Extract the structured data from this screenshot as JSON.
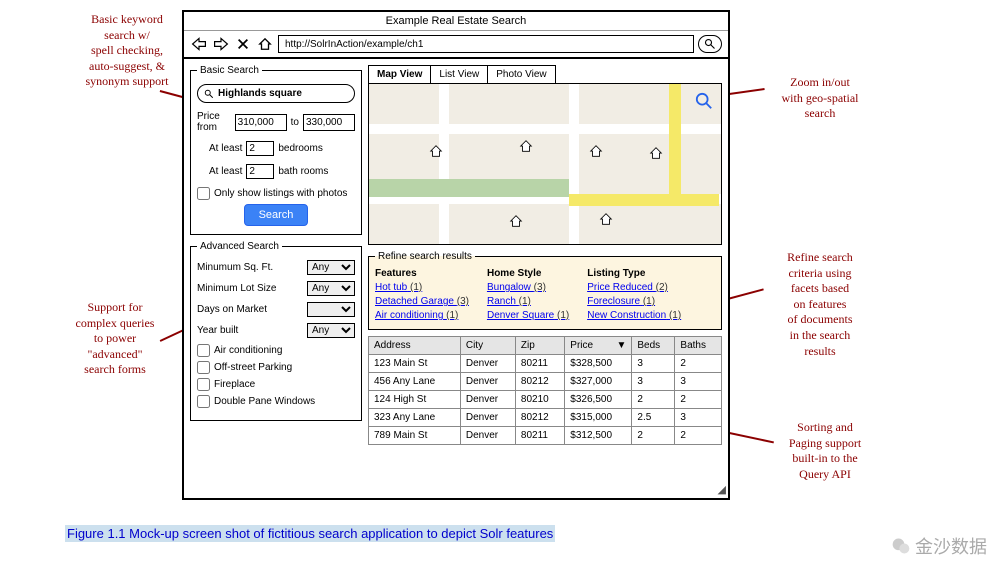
{
  "annotations": {
    "a1": "Basic keyword\nsearch w/\nspell checking,\nauto-suggest, &\nsynonym support",
    "a2": "Support for\ncomplex queries\nto power\n\"advanced\"\nsearch forms",
    "a3": "Zoom in/out\nwith geo-spatial\nsearch",
    "a4": "Refine search\ncriteria using\nfacets based\non features\nof documents\nin the search\nresults",
    "a5": "Sorting and\nPaging support\nbuilt-in to the\nQuery API"
  },
  "window": {
    "title": "Example Real Estate Search",
    "url": "http://SolrInAction/example/ch1"
  },
  "basic": {
    "legend": "Basic Search",
    "query": "Highlands square",
    "price_from_label": "Price from",
    "price_from": "310,000",
    "to": "to",
    "price_to": "330,000",
    "atleast1": "At least",
    "beds_val": "2",
    "bedrooms": "bedrooms",
    "atleast2": "At least",
    "baths_val": "2",
    "bathrooms": "bath rooms",
    "photos_only": "Only show listings with photos",
    "search_btn": "Search"
  },
  "advanced": {
    "legend": "Advanced Search",
    "sqft": "Minumum Sq. Ft.",
    "lot": "Minimum Lot Size",
    "days": "Days on Market",
    "year": "Year built",
    "any": "Any",
    "ac": "Air conditioning",
    "parking": "Off-street Parking",
    "fireplace": "Fireplace",
    "windows": "Double Pane Windows"
  },
  "tabs": {
    "map": "Map View",
    "list": "List View",
    "photo": "Photo View"
  },
  "refine": {
    "legend": "Refine search results",
    "features": "Features",
    "f1": "Hot tub",
    "f1c": "(1)",
    "f2": "Detached Garage",
    "f2c": "(3)",
    "f3": "Air conditioning",
    "f3c": "(1)",
    "home": "Home Style",
    "h1": "Bungalow",
    "h1c": "(3)",
    "h2": "Ranch",
    "h2c": "(1)",
    "h3": "Denver Square",
    "h3c": "(1)",
    "listing": "Listing Type",
    "l1": "Price Reduced",
    "l1c": "(2)",
    "l2": "Foreclosure",
    "l2c": "(1)",
    "l3": "New Construction",
    "l3c": "(1)"
  },
  "table": {
    "cols": {
      "address": "Address",
      "city": "City",
      "zip": "Zip",
      "price": "Price",
      "beds": "Beds",
      "baths": "Baths"
    },
    "rows": [
      {
        "address": "123 Main St",
        "city": "Denver",
        "zip": "80211",
        "price": "$328,500",
        "beds": "3",
        "baths": "2"
      },
      {
        "address": "456 Any Lane",
        "city": "Denver",
        "zip": "80212",
        "price": "$327,000",
        "beds": "3",
        "baths": "3"
      },
      {
        "address": "124 High St",
        "city": "Denver",
        "zip": "80210",
        "price": "$326,500",
        "beds": "2",
        "baths": "2"
      },
      {
        "address": "323 Any Lane",
        "city": "Denver",
        "zip": "80212",
        "price": "$315,000",
        "beds": "2.5",
        "baths": "3"
      },
      {
        "address": "789 Main St",
        "city": "Denver",
        "zip": "80211",
        "price": "$312,500",
        "beds": "2",
        "baths": "2"
      }
    ]
  },
  "caption": "Figure 1.1 Mock-up screen shot of fictitious search application to depict Solr features",
  "watermark": "金沙数据"
}
